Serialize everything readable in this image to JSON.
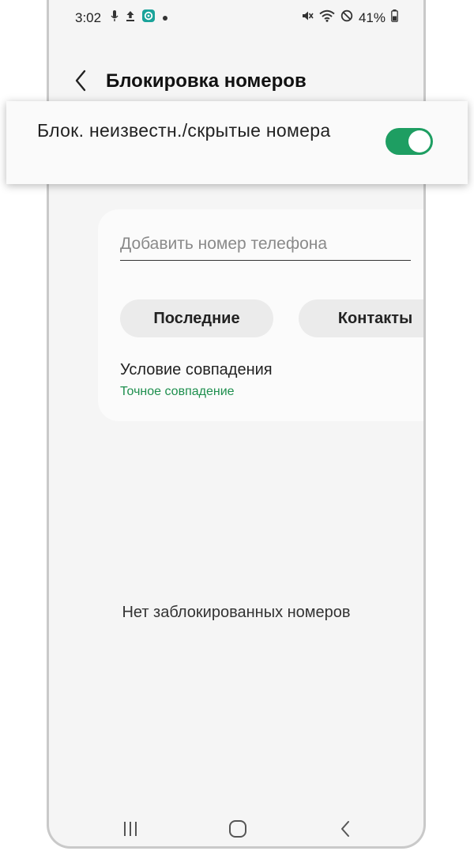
{
  "status_bar": {
    "time": "3:02",
    "battery_percent": "41%",
    "left_icons": [
      "microphone-icon",
      "upload-icon",
      "app-notification-icon",
      "dot-icon"
    ],
    "right_icons": [
      "mute-icon",
      "wifi-icon",
      "do-not-disturb-icon",
      "battery-icon"
    ]
  },
  "header": {
    "title": "Блокировка номеров",
    "back_icon": "chevron-left-icon"
  },
  "toggle": {
    "label": "Блок. неизвестн./скрытые номера",
    "state": "on",
    "accent": "#1e9e62"
  },
  "add_number": {
    "placeholder": "Добавить номер телефона",
    "value": "",
    "add_icon": "plus-icon",
    "add_icon_color": "#6cd49a"
  },
  "buttons": {
    "recent": "Последние",
    "contacts": "Контакты"
  },
  "match_condition": {
    "title": "Условие совпадения",
    "value": "Точное совпадение",
    "value_color": "#1e8f4e"
  },
  "empty_message": "Нет заблокированных номеров",
  "navbar": {
    "icons": [
      "recents-icon",
      "home-icon",
      "back-icon"
    ]
  }
}
